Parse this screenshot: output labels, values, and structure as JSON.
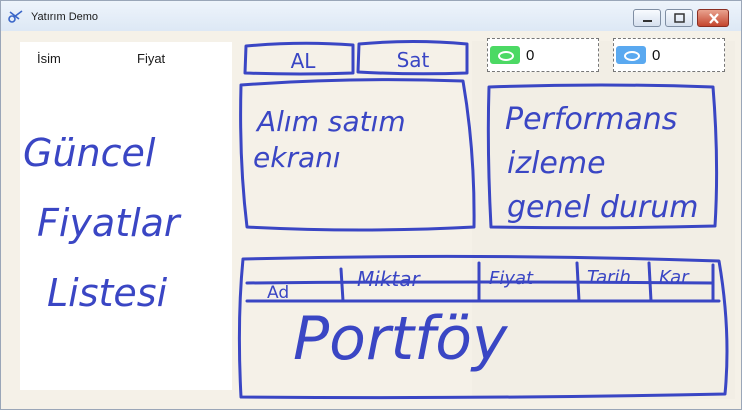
{
  "window": {
    "title": "Yatırım Demo",
    "icon": "scissors-icon"
  },
  "list": {
    "col_name": "İsim",
    "col_price": "Fiyat",
    "note": "Güncel Fiyatlar Listesi"
  },
  "trade": {
    "buy_label": "AL",
    "sell_label": "Sat",
    "note": "Alım satım ekranı"
  },
  "balances": [
    {
      "color": "#4cd964",
      "value": "0"
    },
    {
      "color": "#5aa9f0",
      "value": "0"
    }
  ],
  "performance": {
    "note": "Performans izleme genel durum"
  },
  "portfolio": {
    "columns": [
      "Ad",
      "Miktar",
      "Fiyat",
      "Tarih",
      "Kar"
    ],
    "note": "Portföy"
  }
}
